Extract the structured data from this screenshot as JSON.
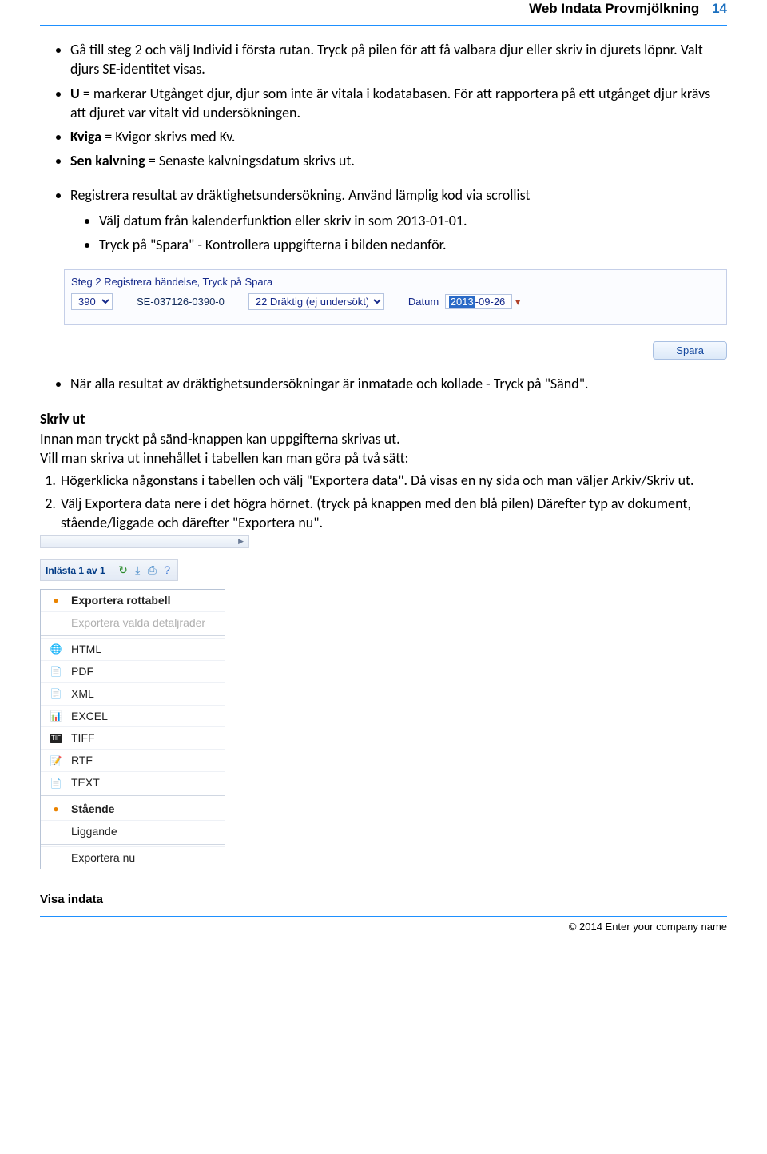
{
  "header": {
    "title": "Web Indata Provmjölkning",
    "page": "14"
  },
  "bullets1": [
    "Gå till steg 2 och välj Individ i första rutan. Tryck på pilen för att få valbara djur eller skriv in djurets löpnr. Valt djurs SE-identitet visas."
  ],
  "bullets2_prefix": "U",
  "bullets2_line1": " = markerar Utgånget djur, djur som inte är vitala i kodatabasen. För att rapportera på ett utgånget djur krävs att djuret var vitalt vid undersökningen.",
  "bullets2_kviga_b": "Kviga",
  "bullets2_kviga_t": " = Kvigor skrivs med Kv.",
  "bullets2_sen_b": "Sen kalvning",
  "bullets2_sen_t": " = Senaste kalvningsdatum skrivs ut.",
  "bullets3": "Registrera resultat av dräktighetsundersökning. Använd lämplig kod via scrollist",
  "bullets3_sub1": "Välj datum från kalenderfunktion eller skriv in som 2013-01-01.",
  "bullets3_sub2": "Tryck på \"Spara\" - Kontrollera uppgifterna i bilden nedanför.",
  "panel": {
    "title": "Steg 2 Registrera händelse, Tryck på Spara",
    "select1": "390",
    "se": "SE-037126-0390-0",
    "select2": "22 Dräktig (ej undersökt)",
    "datum_label": "Datum",
    "date_hl": "2013",
    "date_rest": "-09-26"
  },
  "save_btn": "Spara",
  "bullets4": "När alla resultat av dräktighetsundersökningar är inmatade och kollade - Tryck på \"Sänd\".",
  "skriv_title": "Skriv ut",
  "skriv_p1": "Innan man tryckt på sänd-knappen kan uppgifterna skrivas ut.",
  "skriv_p2": "Vill man skriva ut innehållet i tabellen kan man göra på två sätt:",
  "num1": "Högerklicka någonstans i tabellen och välj \"Exportera data\". Då visas en ny sida och man väljer Arkiv/Skriv ut.",
  "num2": "Välj Exportera data nere i det högra hörnet. (tryck på knappen med den blå pilen) Därefter typ av dokument, stående/liggade och därefter \"Exportera nu\".",
  "toolbar": {
    "label": "Inlästa 1 av 1"
  },
  "menu": {
    "rot": "Exportera rottabell",
    "valda": "Exportera valda detaljrader",
    "html": "HTML",
    "pdf": "PDF",
    "xml": "XML",
    "excel": "EXCEL",
    "tiff": "TIFF",
    "rtf": "RTF",
    "text": "TEXT",
    "staende": "Stående",
    "liggande": "Liggande",
    "nu": "Exportera nu"
  },
  "visa": "Visa indata",
  "footer": "© 2014 Enter your company name"
}
